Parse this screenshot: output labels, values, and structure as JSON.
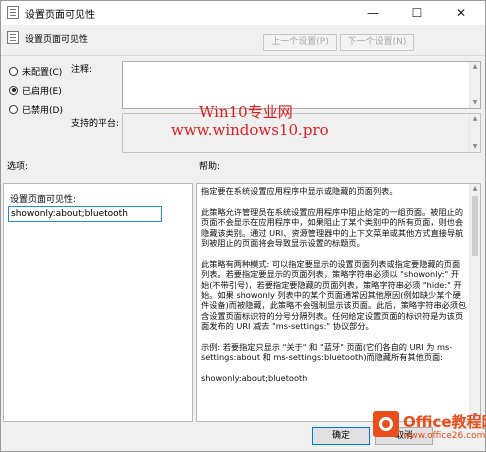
{
  "window": {
    "title": "设置页面可见性",
    "controls": {
      "minimize": "—",
      "maximize": "☐",
      "close": "✕"
    }
  },
  "toolbar": {
    "title": "设置页面可见性",
    "prev_label": "上一个设置(P)",
    "next_label": "下一个设置(N)"
  },
  "state_options": [
    {
      "label": "未配置(C)",
      "selected": false
    },
    {
      "label": "已启用(E)",
      "selected": true
    },
    {
      "label": "已禁用(D)",
      "selected": false
    }
  ],
  "fields": {
    "comment_label": "注释:",
    "platform_label": "支持的平台:"
  },
  "sections": {
    "options_label": "选项:",
    "help_label": "帮助:"
  },
  "options_panel": {
    "field_label": "设置页面可见性:",
    "field_value": "showonly:about;bluetooth"
  },
  "help": {
    "paragraphs": [
      "指定要在系统设置应用程序中显示或隐藏的页面列表。",
      "此策略允许管理员在系统设置应用程序中阻止给定的一组页面。被阻止的页面不会显示在应用程序中，如果阻止了某个类别中的所有页面，则也会隐藏该类别。通过 URI、资源管理器中的上下文菜单或其他方式直接导航到被阻止的页面将会导致显示设置的标题页。",
      "此策略有两种模式: 可以指定要显示的设置页面列表或指定要隐藏的页面列表。若要指定要显示的页面列表，策略字符串必须以 \"showonly:\" 开始(不带引号)，若要指定要隐藏的页面列表，策略字符串必须 \"hide:\" 开始。如果 showonly 列表中的某个页面通常因其他原因(例如缺少某个硬件设备)而被隐藏，此策略不会强制显示该页面。此后，策略字符串必须包含设置页面标识符的分号分隔列表。任何给定设置页面的标识符是为该页面发布的 URI 减去 \"ms-settings:\" 协议部分。",
      "示例: 若要指定只显示 \"关于\" 和 \"蓝牙\" 页面(它们各自的 URI 为 ms-settings:about 和 ms-settings:bluetooth)而隐藏所有其他页面:",
      "showonly:about;bluetooth"
    ]
  },
  "buttons": {
    "ok_label": "确定",
    "cancel_label": "取消"
  },
  "watermark": {
    "line1": "Win10专业网",
    "line2": "www.windows10.pro"
  },
  "logo": {
    "name": "Office教程网",
    "url": "www.office26.com"
  }
}
